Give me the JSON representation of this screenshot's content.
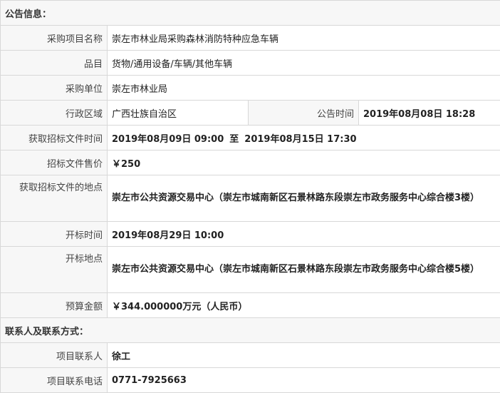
{
  "announcement": {
    "section_title": "公告信息：",
    "rows": {
      "project_name": {
        "label": "采购项目名称",
        "value": "崇左市林业局采购森林消防特种应急车辆"
      },
      "category": {
        "label": "品目",
        "value": "货物/通用设备/车辆/其他车辆"
      },
      "purchaser": {
        "label": "采购单位",
        "value": "崇左市林业局"
      },
      "region": {
        "label": "行政区域",
        "value": "广西壮族自治区"
      },
      "announce_time": {
        "label": "公告时间",
        "value": "2019年08月08日 18:28"
      },
      "doc_time": {
        "label": "获取招标文件时间",
        "start": "2019年08月09日 09:00",
        "sep": "至",
        "end": "2019年08月15日 17:30"
      },
      "doc_price": {
        "label": "招标文件售价",
        "value": "￥250"
      },
      "doc_location": {
        "label": "获取招标文件的地点",
        "value": "崇左市公共资源交易中心（崇左市城南新区石景林路东段崇左市政务服务中心综合楼3楼）"
      },
      "open_time": {
        "label": "开标时间",
        "value": "2019年08月29日 10:00"
      },
      "open_location": {
        "label": "开标地点",
        "value": "崇左市公共资源交易中心（崇左市城南新区石景林路东段崇左市政务服务中心综合楼5楼）"
      },
      "budget": {
        "label": "预算金额",
        "value": "￥344.000000万元（人民币）"
      }
    }
  },
  "contacts": {
    "section_title": "联系人及联系方式：",
    "rows": {
      "contact_person": {
        "label": "项目联系人",
        "value": "徐工"
      },
      "contact_phone": {
        "label": "项目联系电话",
        "value": "0771-7925663"
      }
    }
  }
}
